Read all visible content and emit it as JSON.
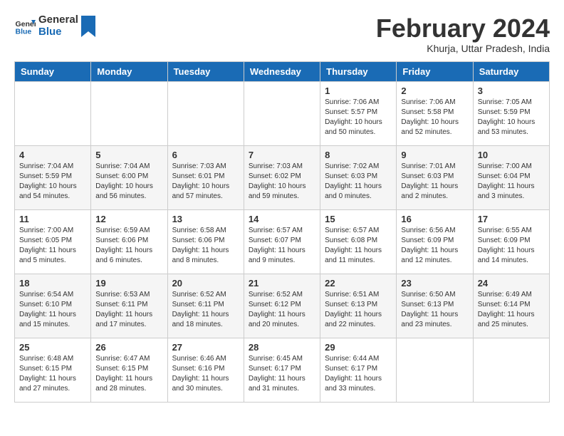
{
  "header": {
    "logo_general": "General",
    "logo_blue": "Blue",
    "month_year": "February 2024",
    "location": "Khurja, Uttar Pradesh, India"
  },
  "days_of_week": [
    "Sunday",
    "Monday",
    "Tuesday",
    "Wednesday",
    "Thursday",
    "Friday",
    "Saturday"
  ],
  "weeks": [
    [
      {
        "day": "",
        "info": ""
      },
      {
        "day": "",
        "info": ""
      },
      {
        "day": "",
        "info": ""
      },
      {
        "day": "",
        "info": ""
      },
      {
        "day": "1",
        "info": "Sunrise: 7:06 AM\nSunset: 5:57 PM\nDaylight: 10 hours\nand 50 minutes."
      },
      {
        "day": "2",
        "info": "Sunrise: 7:06 AM\nSunset: 5:58 PM\nDaylight: 10 hours\nand 52 minutes."
      },
      {
        "day": "3",
        "info": "Sunrise: 7:05 AM\nSunset: 5:59 PM\nDaylight: 10 hours\nand 53 minutes."
      }
    ],
    [
      {
        "day": "4",
        "info": "Sunrise: 7:04 AM\nSunset: 5:59 PM\nDaylight: 10 hours\nand 54 minutes."
      },
      {
        "day": "5",
        "info": "Sunrise: 7:04 AM\nSunset: 6:00 PM\nDaylight: 10 hours\nand 56 minutes."
      },
      {
        "day": "6",
        "info": "Sunrise: 7:03 AM\nSunset: 6:01 PM\nDaylight: 10 hours\nand 57 minutes."
      },
      {
        "day": "7",
        "info": "Sunrise: 7:03 AM\nSunset: 6:02 PM\nDaylight: 10 hours\nand 59 minutes."
      },
      {
        "day": "8",
        "info": "Sunrise: 7:02 AM\nSunset: 6:03 PM\nDaylight: 11 hours\nand 0 minutes."
      },
      {
        "day": "9",
        "info": "Sunrise: 7:01 AM\nSunset: 6:03 PM\nDaylight: 11 hours\nand 2 minutes."
      },
      {
        "day": "10",
        "info": "Sunrise: 7:00 AM\nSunset: 6:04 PM\nDaylight: 11 hours\nand 3 minutes."
      }
    ],
    [
      {
        "day": "11",
        "info": "Sunrise: 7:00 AM\nSunset: 6:05 PM\nDaylight: 11 hours\nand 5 minutes."
      },
      {
        "day": "12",
        "info": "Sunrise: 6:59 AM\nSunset: 6:06 PM\nDaylight: 11 hours\nand 6 minutes."
      },
      {
        "day": "13",
        "info": "Sunrise: 6:58 AM\nSunset: 6:06 PM\nDaylight: 11 hours\nand 8 minutes."
      },
      {
        "day": "14",
        "info": "Sunrise: 6:57 AM\nSunset: 6:07 PM\nDaylight: 11 hours\nand 9 minutes."
      },
      {
        "day": "15",
        "info": "Sunrise: 6:57 AM\nSunset: 6:08 PM\nDaylight: 11 hours\nand 11 minutes."
      },
      {
        "day": "16",
        "info": "Sunrise: 6:56 AM\nSunset: 6:09 PM\nDaylight: 11 hours\nand 12 minutes."
      },
      {
        "day": "17",
        "info": "Sunrise: 6:55 AM\nSunset: 6:09 PM\nDaylight: 11 hours\nand 14 minutes."
      }
    ],
    [
      {
        "day": "18",
        "info": "Sunrise: 6:54 AM\nSunset: 6:10 PM\nDaylight: 11 hours\nand 15 minutes."
      },
      {
        "day": "19",
        "info": "Sunrise: 6:53 AM\nSunset: 6:11 PM\nDaylight: 11 hours\nand 17 minutes."
      },
      {
        "day": "20",
        "info": "Sunrise: 6:52 AM\nSunset: 6:11 PM\nDaylight: 11 hours\nand 18 minutes."
      },
      {
        "day": "21",
        "info": "Sunrise: 6:52 AM\nSunset: 6:12 PM\nDaylight: 11 hours\nand 20 minutes."
      },
      {
        "day": "22",
        "info": "Sunrise: 6:51 AM\nSunset: 6:13 PM\nDaylight: 11 hours\nand 22 minutes."
      },
      {
        "day": "23",
        "info": "Sunrise: 6:50 AM\nSunset: 6:13 PM\nDaylight: 11 hours\nand 23 minutes."
      },
      {
        "day": "24",
        "info": "Sunrise: 6:49 AM\nSunset: 6:14 PM\nDaylight: 11 hours\nand 25 minutes."
      }
    ],
    [
      {
        "day": "25",
        "info": "Sunrise: 6:48 AM\nSunset: 6:15 PM\nDaylight: 11 hours\nand 27 minutes."
      },
      {
        "day": "26",
        "info": "Sunrise: 6:47 AM\nSunset: 6:15 PM\nDaylight: 11 hours\nand 28 minutes."
      },
      {
        "day": "27",
        "info": "Sunrise: 6:46 AM\nSunset: 6:16 PM\nDaylight: 11 hours\nand 30 minutes."
      },
      {
        "day": "28",
        "info": "Sunrise: 6:45 AM\nSunset: 6:17 PM\nDaylight: 11 hours\nand 31 minutes."
      },
      {
        "day": "29",
        "info": "Sunrise: 6:44 AM\nSunset: 6:17 PM\nDaylight: 11 hours\nand 33 minutes."
      },
      {
        "day": "",
        "info": ""
      },
      {
        "day": "",
        "info": ""
      }
    ]
  ]
}
